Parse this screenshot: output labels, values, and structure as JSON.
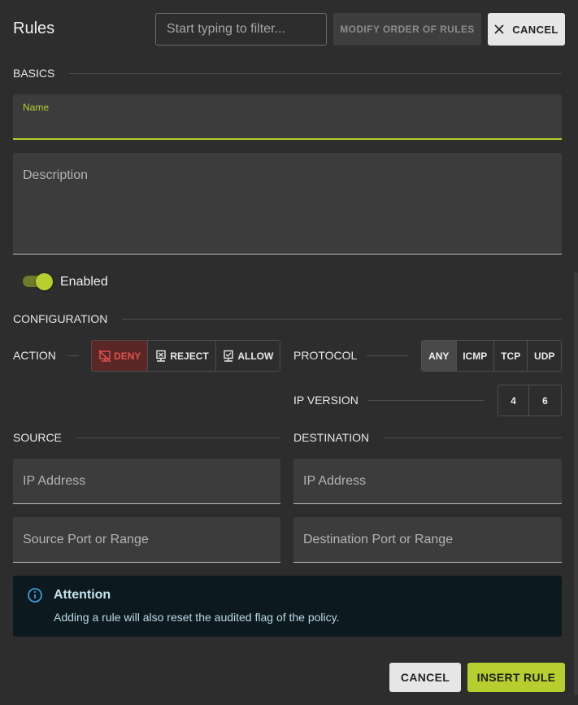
{
  "header": {
    "title": "Rules",
    "filter_placeholder": "Start typing to filter...",
    "modify_order_label": "MODIFY ORDER OF RULES",
    "cancel_label": "CANCEL"
  },
  "basics": {
    "heading": "BASICS",
    "name_label": "Name",
    "name_value": "",
    "description_placeholder": "Description",
    "enabled_label": "Enabled",
    "enabled": true
  },
  "configuration": {
    "heading": "CONFIGURATION",
    "action": {
      "label": "ACTION",
      "options": [
        "DENY",
        "REJECT",
        "ALLOW"
      ],
      "selected": "DENY"
    },
    "protocol": {
      "label": "PROTOCOL",
      "options": [
        "ANY",
        "ICMP",
        "TCP",
        "UDP"
      ],
      "selected": "ANY"
    },
    "ip_version": {
      "label": "IP VERSION",
      "options": [
        "4",
        "6"
      ]
    }
  },
  "source": {
    "heading": "SOURCE",
    "ip_placeholder": "IP Address",
    "port_placeholder": "Source Port or Range"
  },
  "destination": {
    "heading": "DESTINATION",
    "ip_placeholder": "IP Address",
    "port_placeholder": "Destination Port or Range"
  },
  "attention": {
    "title": "Attention",
    "text": "Adding a rule will also reset the audited flag of the policy."
  },
  "footer": {
    "cancel_label": "CANCEL",
    "insert_label": "INSERT RULE"
  },
  "colors": {
    "accent": "#b7cf2e",
    "deny": "#e0514e",
    "background": "#2d2d2d",
    "info": "#0c1a20"
  }
}
